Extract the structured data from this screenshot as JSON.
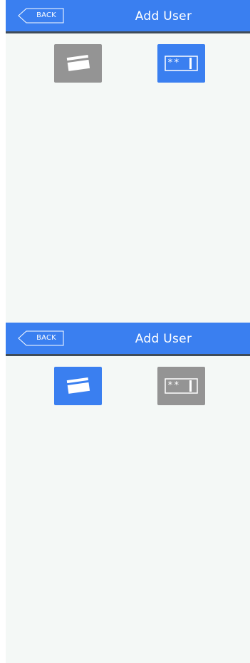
{
  "screens": [
    {
      "header": {
        "back_label": "BACK",
        "title": "Add User"
      },
      "options": {
        "card": {
          "icon": "card-icon",
          "state": "inactive"
        },
        "pin": {
          "icon": "pin-code-icon",
          "text": "**",
          "state": "active"
        }
      }
    },
    {
      "header": {
        "back_label": "BACK",
        "title": "Add User"
      },
      "options": {
        "card": {
          "icon": "card-icon",
          "state": "active"
        },
        "pin": {
          "icon": "pin-code-icon",
          "text": "**",
          "state": "inactive"
        }
      }
    }
  ],
  "colors": {
    "accent": "#3a7ff0",
    "inactive": "#949494",
    "background": "#f4f8f6",
    "header_border": "#3f4c5a"
  }
}
